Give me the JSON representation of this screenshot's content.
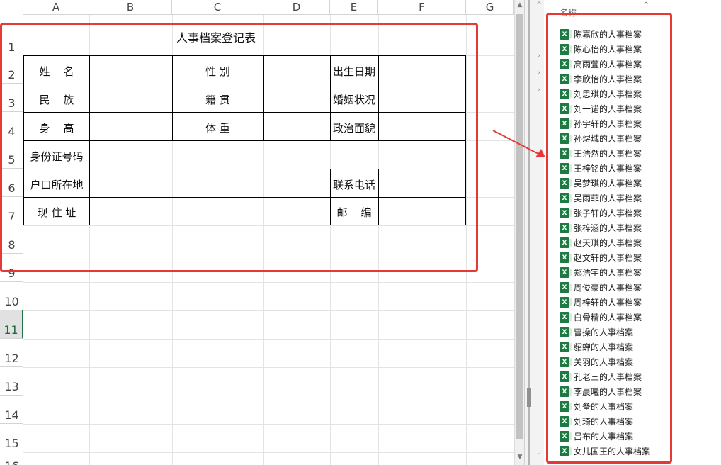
{
  "sheet": {
    "columns": [
      "A",
      "B",
      "C",
      "D",
      "E",
      "F",
      "G"
    ],
    "rows": [
      "1",
      "2",
      "3",
      "4",
      "5",
      "6",
      "7",
      "8",
      "9",
      "10",
      "11",
      "12",
      "13",
      "14",
      "15",
      "16"
    ],
    "selected_row": "11"
  },
  "form": {
    "title": "人事档案登记表",
    "labels": {
      "name": "姓    名",
      "gender": "性 别",
      "birth_date": "出生日期",
      "ethnicity": "民    族",
      "native_place": "籍 贯",
      "marital_status": "婚姻状况",
      "height": "身    高",
      "weight": "体 重",
      "political_status": "政治面貌",
      "id_number": "身份证号码",
      "household_address": "户口所在地",
      "phone": "联系电话",
      "current_address": "现 住 址",
      "postcode": "邮    编"
    }
  },
  "file_list": {
    "header": "名称",
    "files": [
      "陈嘉欣的人事档案",
      "陈心怡的人事档案",
      "高雨萱的人事档案",
      "李欣怡的人事档案",
      "刘思琪的人事档案",
      "刘一诺的人事档案",
      "孙宇轩的人事档案",
      "孙煜城的人事档案",
      "王浩然的人事档案",
      "王梓铭的人事档案",
      "吴梦琪的人事档案",
      "吴雨菲的人事档案",
      "张子轩的人事档案",
      "张梓涵的人事档案",
      "赵天琪的人事档案",
      "赵文轩的人事档案",
      "郑浩宇的人事档案",
      "周俊豪的人事档案",
      "周梓轩的人事档案",
      "白骨精的人事档案",
      "曹操的人事档案",
      "貂蝉的人事档案",
      "关羽的人事档案",
      "孔老三的人事档案",
      "李晨曦的人事档案",
      "刘备的人事档案",
      "刘琦的人事档案",
      "吕布的人事档案",
      "女儿国王的人事档案"
    ]
  },
  "colors": {
    "excel_green": "#1d7a43",
    "highlight_red": "#e53935"
  }
}
